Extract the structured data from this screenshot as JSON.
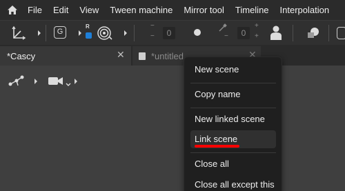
{
  "menubar": {
    "icon": "home-icon",
    "items": [
      "File",
      "Edit",
      "View",
      "Tween machine",
      "Mirror tool",
      "Timeline",
      "Interpolation"
    ]
  },
  "toolbar": {
    "g_label": "G",
    "r_label": "R",
    "offset_value_1": "0",
    "offset_value_2": "0",
    "minus_label": "−",
    "plus_label": "+"
  },
  "tabs": [
    {
      "label": "*Cascy",
      "active": true
    },
    {
      "label": "*untitled",
      "active": false
    }
  ],
  "tab_close_glyph": "✕",
  "context_menu": {
    "items": [
      "New scene",
      "Copy name",
      "New linked scene",
      "Link scene",
      "Close all",
      "Close all except this"
    ],
    "highlighted": "Link scene"
  },
  "colors": {
    "accent_underline": "#ff0000",
    "r_badge_blue": "#1e7fd8"
  }
}
